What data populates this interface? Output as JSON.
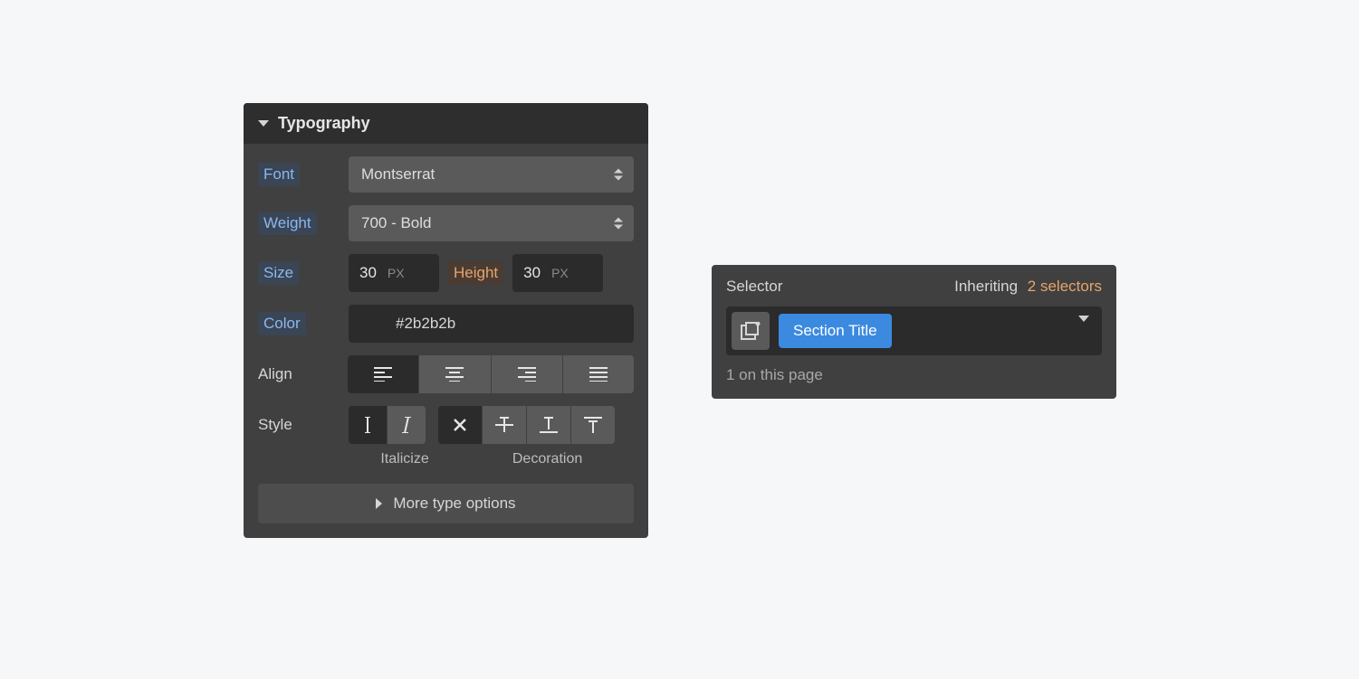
{
  "typography": {
    "title": "Typography",
    "labels": {
      "font": "Font",
      "weight": "Weight",
      "size": "Size",
      "height": "Height",
      "color": "Color",
      "align": "Align",
      "style": "Style",
      "italicize": "Italicize",
      "decoration": "Decoration",
      "more": "More type options"
    },
    "font_value": "Montserrat",
    "weight_value": "700 - Bold",
    "size_value": "30",
    "size_unit": "PX",
    "height_value": "30",
    "height_unit": "PX",
    "color_value": "#2b2b2b"
  },
  "selector": {
    "label": "Selector",
    "inheriting_label": "Inheriting",
    "inheriting_count": "2 selectors",
    "tag": "Section Title",
    "page_count": "1 on this page"
  }
}
